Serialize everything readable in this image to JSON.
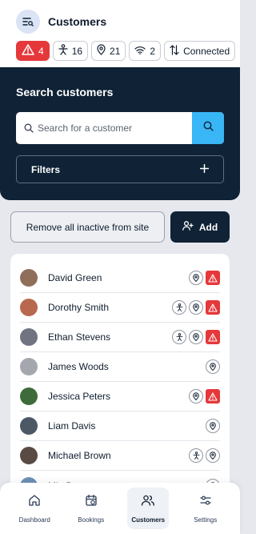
{
  "header": {
    "title": "Customers",
    "icon": "filter-list-icon",
    "chips": [
      {
        "icon": "warning-icon",
        "value": "4"
      },
      {
        "icon": "person-icon",
        "value": "16"
      },
      {
        "icon": "location-pin-icon",
        "value": "21"
      },
      {
        "icon": "wifi-icon",
        "value": "2"
      },
      {
        "icon": "sync-arrows-icon",
        "value": "Connected"
      }
    ]
  },
  "search": {
    "title": "Search customers",
    "placeholder": "Search for a customer",
    "filters_label": "Filters"
  },
  "actions": {
    "remove_label": "Remove all inactive from site",
    "add_label": "Add"
  },
  "customers": [
    {
      "name": "David Green",
      "icons": [
        "location",
        "warning"
      ]
    },
    {
      "name": "Dorothy Smith",
      "icons": [
        "person",
        "location",
        "warning"
      ]
    },
    {
      "name": "Ethan Stevens",
      "icons": [
        "person",
        "location",
        "warning"
      ]
    },
    {
      "name": "James Woods",
      "icons": [
        "location"
      ]
    },
    {
      "name": "Jessica Peters",
      "icons": [
        "location",
        "warning"
      ]
    },
    {
      "name": "Liam Davis",
      "icons": [
        "location"
      ]
    },
    {
      "name": "Michael Brown",
      "icons": [
        "person",
        "location"
      ]
    },
    {
      "name": "Mia Dean",
      "icons": [
        "location"
      ]
    }
  ],
  "nav": [
    {
      "label": "Dashboard",
      "icon": "home-icon",
      "active": false
    },
    {
      "label": "Bookings",
      "icon": "calendar-icon",
      "active": false
    },
    {
      "label": "Customers",
      "icon": "users-icon",
      "active": true
    },
    {
      "label": "Settings",
      "icon": "sliders-icon",
      "active": false
    }
  ],
  "colors": {
    "navy": "#0f2236",
    "alert": "#e5383b",
    "accent": "#38b6f5",
    "background": "#e6e8ee"
  }
}
